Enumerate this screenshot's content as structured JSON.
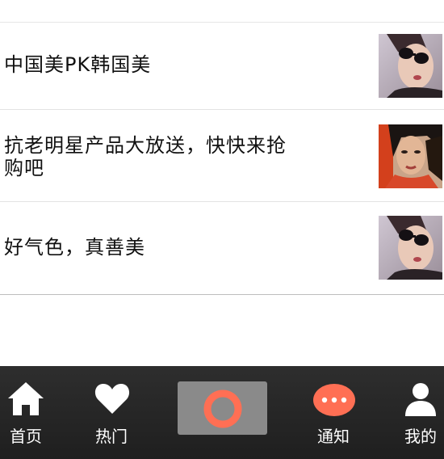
{
  "feed": {
    "items": [
      {
        "title": "中国美PK韩国美",
        "thumbnail": "woman-sunglasses-photo"
      },
      {
        "title": "抗老明星产品大放送，快快来抢购吧",
        "thumbnail": "woman-portrait-photo"
      },
      {
        "title": "好气色，真善美",
        "thumbnail": "woman-sunglasses-photo"
      }
    ]
  },
  "tabbar": {
    "home_label": "首页",
    "hot_label": "热门",
    "notify_label": "通知",
    "me_label": "我的",
    "center_icon": "ring-icon",
    "accent_color": "#ff6f54"
  }
}
